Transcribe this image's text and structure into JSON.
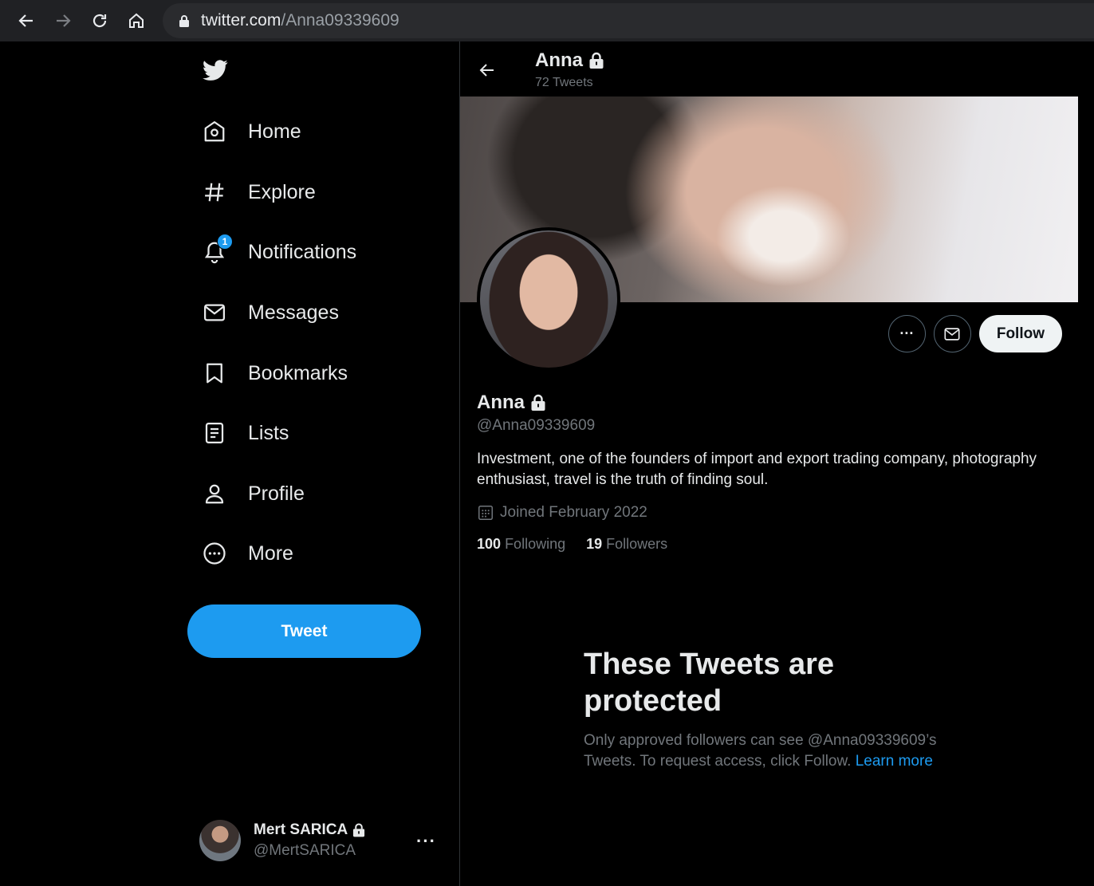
{
  "browser": {
    "url_host": "twitter.com",
    "url_path": "/Anna09339609"
  },
  "sidebar": {
    "items": [
      {
        "label": "Home",
        "icon": "home-icon"
      },
      {
        "label": "Explore",
        "icon": "hashtag-icon"
      },
      {
        "label": "Notifications",
        "icon": "bell-icon",
        "badge": "1"
      },
      {
        "label": "Messages",
        "icon": "envelope-icon"
      },
      {
        "label": "Bookmarks",
        "icon": "bookmark-icon"
      },
      {
        "label": "Lists",
        "icon": "list-icon"
      },
      {
        "label": "Profile",
        "icon": "person-icon"
      },
      {
        "label": "More",
        "icon": "more-circle-icon"
      }
    ],
    "tweet_button": "Tweet",
    "account": {
      "name": "Mert SARICA",
      "handle": "@MertSARICA",
      "more": "···"
    }
  },
  "header": {
    "name": "Anna",
    "tweet_count": "72 Tweets"
  },
  "profile": {
    "name": "Anna",
    "handle": "@Anna09339609",
    "bio": "Investment, one of the founders of import and export trading company, photography enthusiast, travel is the truth of finding soul.",
    "joined": "Joined February 2022",
    "following_count": "100",
    "following_label": "Following",
    "followers_count": "19",
    "followers_label": "Followers",
    "follow_button": "Follow",
    "more_button": "···"
  },
  "protected": {
    "title": "These Tweets are protected",
    "text": "Only approved followers can see @Anna09339609’s Tweets. To request access, click Follow.",
    "link": "Learn more"
  },
  "colors": {
    "accent": "#1d9bf0",
    "background": "#000000",
    "secondary_text": "#71767b"
  }
}
